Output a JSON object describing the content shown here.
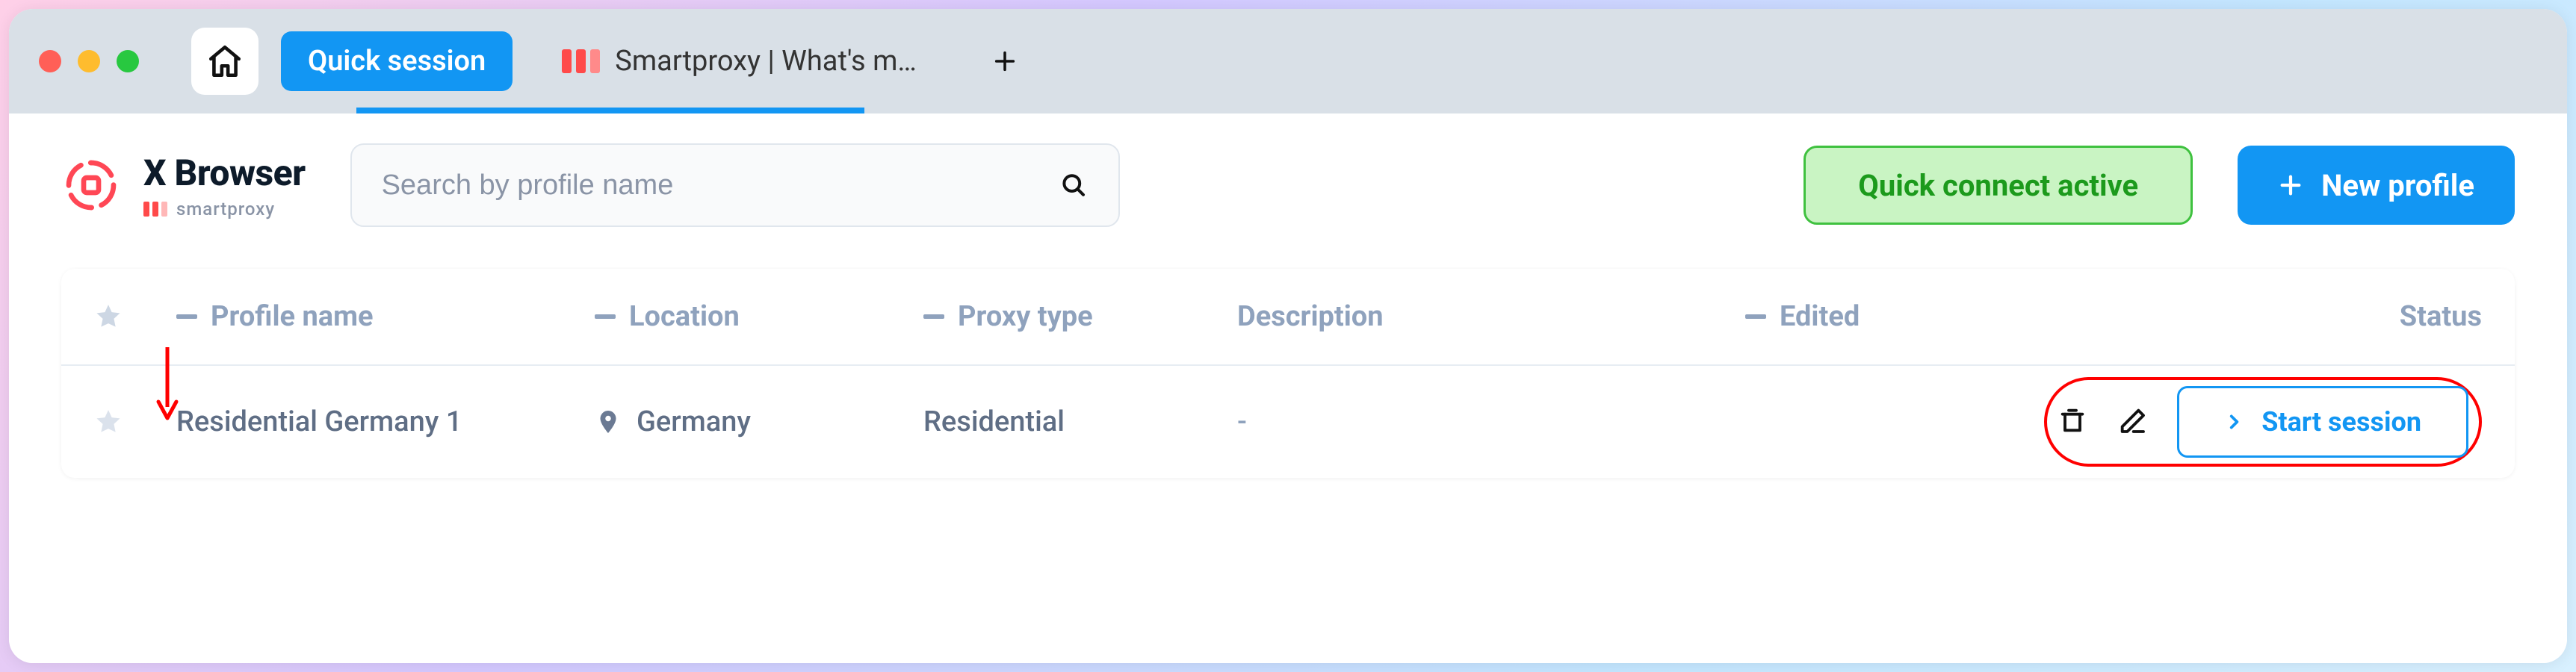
{
  "tabs": {
    "active": "Quick session",
    "inactive": "Smartproxy | What's m…"
  },
  "branding": {
    "title": "X Browser",
    "subtitle": "smartproxy"
  },
  "search": {
    "placeholder": "Search by profile name"
  },
  "status_badge": "Quick connect active",
  "buttons": {
    "new_profile": "New profile",
    "start_session": "Start session"
  },
  "columns": {
    "profile_name": "Profile name",
    "location": "Location",
    "proxy_type": "Proxy type",
    "description": "Description",
    "edited": "Edited",
    "status": "Status"
  },
  "rows": [
    {
      "name": "Residential Germany 1",
      "location": "Germany",
      "proxy_type": "Residential",
      "description": "-",
      "edited": ""
    }
  ]
}
